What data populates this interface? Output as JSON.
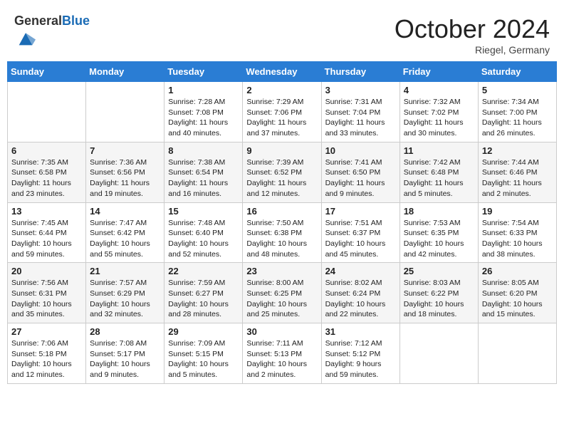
{
  "header": {
    "logo_general": "General",
    "logo_blue": "Blue",
    "month_title": "October 2024",
    "location": "Riegel, Germany"
  },
  "weekdays": [
    "Sunday",
    "Monday",
    "Tuesday",
    "Wednesday",
    "Thursday",
    "Friday",
    "Saturday"
  ],
  "weeks": [
    [
      null,
      null,
      {
        "day": "1",
        "sunrise": "Sunrise: 7:28 AM",
        "sunset": "Sunset: 7:08 PM",
        "daylight": "Daylight: 11 hours and 40 minutes."
      },
      {
        "day": "2",
        "sunrise": "Sunrise: 7:29 AM",
        "sunset": "Sunset: 7:06 PM",
        "daylight": "Daylight: 11 hours and 37 minutes."
      },
      {
        "day": "3",
        "sunrise": "Sunrise: 7:31 AM",
        "sunset": "Sunset: 7:04 PM",
        "daylight": "Daylight: 11 hours and 33 minutes."
      },
      {
        "day": "4",
        "sunrise": "Sunrise: 7:32 AM",
        "sunset": "Sunset: 7:02 PM",
        "daylight": "Daylight: 11 hours and 30 minutes."
      },
      {
        "day": "5",
        "sunrise": "Sunrise: 7:34 AM",
        "sunset": "Sunset: 7:00 PM",
        "daylight": "Daylight: 11 hours and 26 minutes."
      }
    ],
    [
      {
        "day": "6",
        "sunrise": "Sunrise: 7:35 AM",
        "sunset": "Sunset: 6:58 PM",
        "daylight": "Daylight: 11 hours and 23 minutes."
      },
      {
        "day": "7",
        "sunrise": "Sunrise: 7:36 AM",
        "sunset": "Sunset: 6:56 PM",
        "daylight": "Daylight: 11 hours and 19 minutes."
      },
      {
        "day": "8",
        "sunrise": "Sunrise: 7:38 AM",
        "sunset": "Sunset: 6:54 PM",
        "daylight": "Daylight: 11 hours and 16 minutes."
      },
      {
        "day": "9",
        "sunrise": "Sunrise: 7:39 AM",
        "sunset": "Sunset: 6:52 PM",
        "daylight": "Daylight: 11 hours and 12 minutes."
      },
      {
        "day": "10",
        "sunrise": "Sunrise: 7:41 AM",
        "sunset": "Sunset: 6:50 PM",
        "daylight": "Daylight: 11 hours and 9 minutes."
      },
      {
        "day": "11",
        "sunrise": "Sunrise: 7:42 AM",
        "sunset": "Sunset: 6:48 PM",
        "daylight": "Daylight: 11 hours and 5 minutes."
      },
      {
        "day": "12",
        "sunrise": "Sunrise: 7:44 AM",
        "sunset": "Sunset: 6:46 PM",
        "daylight": "Daylight: 11 hours and 2 minutes."
      }
    ],
    [
      {
        "day": "13",
        "sunrise": "Sunrise: 7:45 AM",
        "sunset": "Sunset: 6:44 PM",
        "daylight": "Daylight: 10 hours and 59 minutes."
      },
      {
        "day": "14",
        "sunrise": "Sunrise: 7:47 AM",
        "sunset": "Sunset: 6:42 PM",
        "daylight": "Daylight: 10 hours and 55 minutes."
      },
      {
        "day": "15",
        "sunrise": "Sunrise: 7:48 AM",
        "sunset": "Sunset: 6:40 PM",
        "daylight": "Daylight: 10 hours and 52 minutes."
      },
      {
        "day": "16",
        "sunrise": "Sunrise: 7:50 AM",
        "sunset": "Sunset: 6:38 PM",
        "daylight": "Daylight: 10 hours and 48 minutes."
      },
      {
        "day": "17",
        "sunrise": "Sunrise: 7:51 AM",
        "sunset": "Sunset: 6:37 PM",
        "daylight": "Daylight: 10 hours and 45 minutes."
      },
      {
        "day": "18",
        "sunrise": "Sunrise: 7:53 AM",
        "sunset": "Sunset: 6:35 PM",
        "daylight": "Daylight: 10 hours and 42 minutes."
      },
      {
        "day": "19",
        "sunrise": "Sunrise: 7:54 AM",
        "sunset": "Sunset: 6:33 PM",
        "daylight": "Daylight: 10 hours and 38 minutes."
      }
    ],
    [
      {
        "day": "20",
        "sunrise": "Sunrise: 7:56 AM",
        "sunset": "Sunset: 6:31 PM",
        "daylight": "Daylight: 10 hours and 35 minutes."
      },
      {
        "day": "21",
        "sunrise": "Sunrise: 7:57 AM",
        "sunset": "Sunset: 6:29 PM",
        "daylight": "Daylight: 10 hours and 32 minutes."
      },
      {
        "day": "22",
        "sunrise": "Sunrise: 7:59 AM",
        "sunset": "Sunset: 6:27 PM",
        "daylight": "Daylight: 10 hours and 28 minutes."
      },
      {
        "day": "23",
        "sunrise": "Sunrise: 8:00 AM",
        "sunset": "Sunset: 6:25 PM",
        "daylight": "Daylight: 10 hours and 25 minutes."
      },
      {
        "day": "24",
        "sunrise": "Sunrise: 8:02 AM",
        "sunset": "Sunset: 6:24 PM",
        "daylight": "Daylight: 10 hours and 22 minutes."
      },
      {
        "day": "25",
        "sunrise": "Sunrise: 8:03 AM",
        "sunset": "Sunset: 6:22 PM",
        "daylight": "Daylight: 10 hours and 18 minutes."
      },
      {
        "day": "26",
        "sunrise": "Sunrise: 8:05 AM",
        "sunset": "Sunset: 6:20 PM",
        "daylight": "Daylight: 10 hours and 15 minutes."
      }
    ],
    [
      {
        "day": "27",
        "sunrise": "Sunrise: 7:06 AM",
        "sunset": "Sunset: 5:18 PM",
        "daylight": "Daylight: 10 hours and 12 minutes."
      },
      {
        "day": "28",
        "sunrise": "Sunrise: 7:08 AM",
        "sunset": "Sunset: 5:17 PM",
        "daylight": "Daylight: 10 hours and 9 minutes."
      },
      {
        "day": "29",
        "sunrise": "Sunrise: 7:09 AM",
        "sunset": "Sunset: 5:15 PM",
        "daylight": "Daylight: 10 hours and 5 minutes."
      },
      {
        "day": "30",
        "sunrise": "Sunrise: 7:11 AM",
        "sunset": "Sunset: 5:13 PM",
        "daylight": "Daylight: 10 hours and 2 minutes."
      },
      {
        "day": "31",
        "sunrise": "Sunrise: 7:12 AM",
        "sunset": "Sunset: 5:12 PM",
        "daylight": "Daylight: 9 hours and 59 minutes."
      },
      null,
      null
    ]
  ]
}
